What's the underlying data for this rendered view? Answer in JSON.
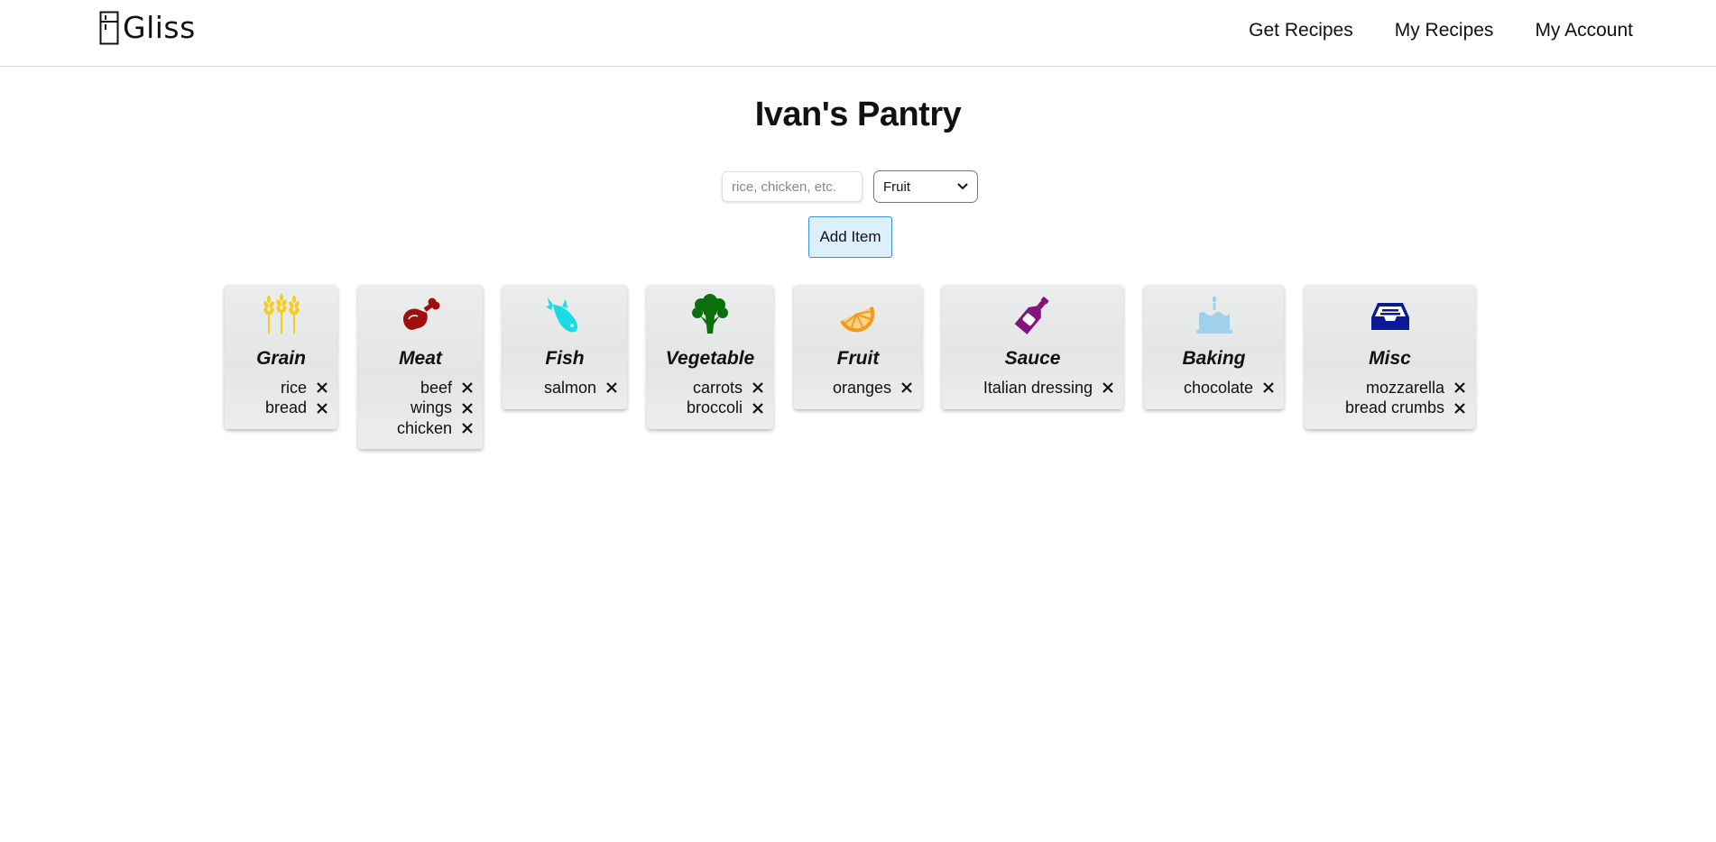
{
  "nav": {
    "brand": "Gliss",
    "links": [
      "Get Recipes",
      "My Recipes",
      "My Account"
    ]
  },
  "pantry": {
    "title": "Ivan's Pantry",
    "input_placeholder": "rice, chicken, etc.",
    "selected_category": "Fruit",
    "add_button": "Add Item"
  },
  "categories": [
    {
      "name": "Grain",
      "icon": "wheat-icon",
      "color": "#f5cc1d",
      "items": [
        "rice",
        "bread"
      ]
    },
    {
      "name": "Meat",
      "icon": "meat-icon",
      "color": "#9e0f0f",
      "items": [
        "beef",
        "wings",
        "chicken"
      ]
    },
    {
      "name": "Fish",
      "icon": "fish-icon",
      "color": "#19dbe6",
      "items": [
        "salmon"
      ]
    },
    {
      "name": "Vegetable",
      "icon": "broccoli-icon",
      "color": "#0c6f0c",
      "items": [
        "carrots",
        "broccoli"
      ]
    },
    {
      "name": "Fruit",
      "icon": "orange-slice-icon",
      "color": "#f39a1a",
      "items": [
        "oranges"
      ]
    },
    {
      "name": "Sauce",
      "icon": "bottle-icon",
      "color": "#86127e",
      "items": [
        "Italian dressing"
      ]
    },
    {
      "name": "Baking",
      "icon": "cake-icon",
      "color": "#9fd1ea",
      "items": [
        "chocolate"
      ]
    },
    {
      "name": "Misc",
      "icon": "inbox-icon",
      "color": "#0b1996",
      "items": [
        "mozzarella",
        "bread crumbs"
      ]
    }
  ]
}
